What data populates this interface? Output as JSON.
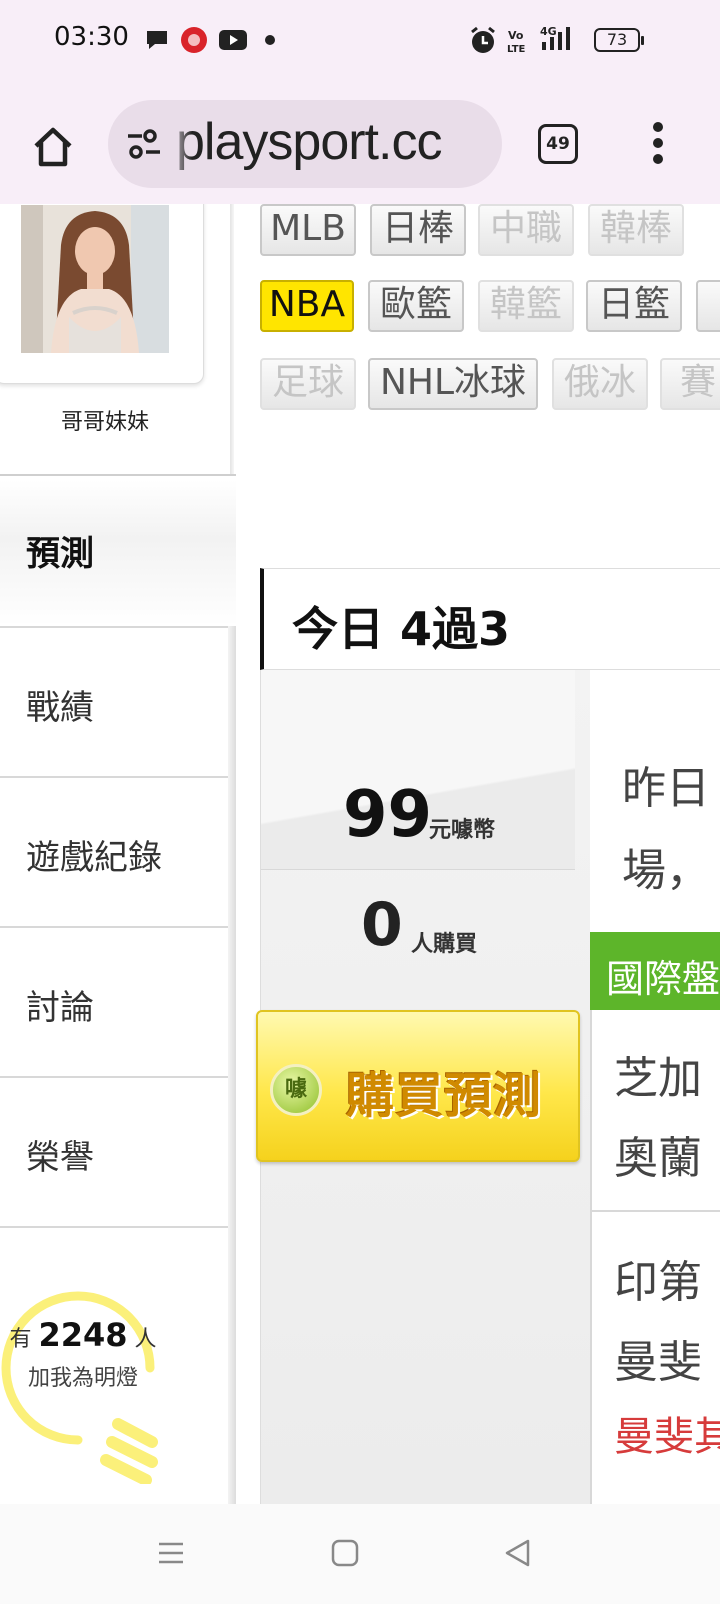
{
  "status_bar": {
    "time": "03:30",
    "icons": [
      "chat-bubble-icon",
      "app-badge-icon",
      "youtube-icon",
      "dot-icon",
      "alarm-icon",
      "volte-icon",
      "signal-4g-icon"
    ],
    "battery": "73"
  },
  "browser": {
    "url": "playsport.cc",
    "tab_count": "49"
  },
  "profile": {
    "name": "哥哥妹妹"
  },
  "tags_row1": [
    "MLB",
    "日棒",
    "中職",
    "韓棒"
  ],
  "tags_row2": [
    "NBA",
    "歐籃",
    "韓籃",
    "日籃",
    ""
  ],
  "tags_row3": [
    "足球",
    "NHL冰球",
    "俄冰",
    "賽"
  ],
  "sidebar": {
    "predict_label": "預測",
    "items": [
      {
        "label": "戰績"
      },
      {
        "label": "遊戲紀錄"
      },
      {
        "label": "討論"
      },
      {
        "label": "榮譽"
      }
    ]
  },
  "fans": {
    "prefix": "有",
    "count": "2248",
    "suffix": "人",
    "line2": "加我為明燈"
  },
  "today": {
    "header": "今日 4過3"
  },
  "purchase": {
    "price": "99",
    "price_unit": "元噱幣",
    "buyers": "0",
    "buyers_unit": "人購買",
    "button_logo": "噱",
    "button_label": "購買預測"
  },
  "yesterday": {
    "line1": "昨日",
    "line2": "場，"
  },
  "games": {
    "section_label": "國際盤",
    "game1_line1": "芝加",
    "game1_line2": "奧蘭",
    "game2_line1": "印第",
    "game2_line2": "曼斐",
    "game2_pick": "曼斐其"
  },
  "colors": {
    "active_tag": "#ffe500",
    "intl_bar": "#5db52a",
    "pick_red": "#d63b3b",
    "chrome_bg": "#f8eef8"
  }
}
